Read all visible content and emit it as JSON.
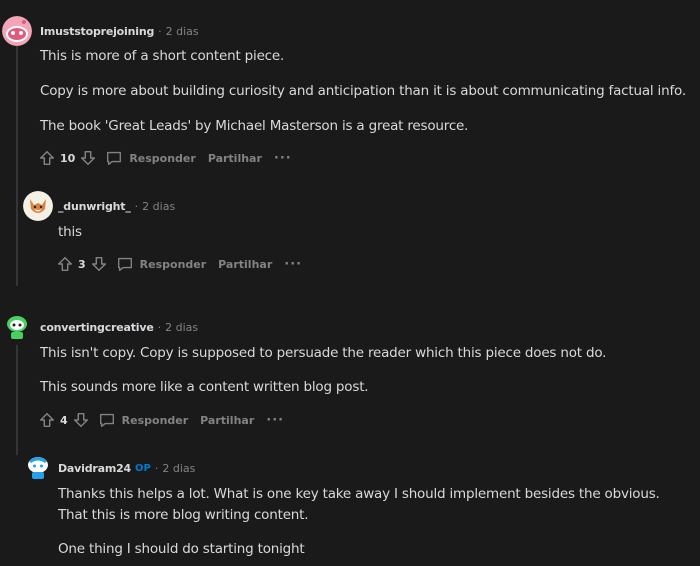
{
  "comments": [
    {
      "username": "Imuststoprejoining",
      "time": "2 dias",
      "avatar_icon": "pink-snoo-avatar-icon",
      "paragraphs": [
        "This is more of a short content piece.",
        "Copy is more about building curiosity and anticipation than it is about communicating factual info.",
        "The book 'Great Leads' by Michael Masterson is a great resource."
      ],
      "votes": "10",
      "reply_label": "Responder",
      "share_label": "Partilhar",
      "more_label": "···"
    },
    {
      "username": "_dunwright_",
      "time": "2 dias",
      "avatar_icon": "fox-avatar-icon",
      "paragraphs": [
        "this"
      ],
      "votes": "3",
      "reply_label": "Responder",
      "share_label": "Partilhar",
      "more_label": "···"
    },
    {
      "username": "convertingcreative",
      "time": "2 dias",
      "avatar_icon": "green-snoo-avatar-icon",
      "paragraphs": [
        "This isn't copy. Copy is supposed to persuade the reader which this piece does not do.",
        "This sounds more like a content written blog post."
      ],
      "votes": "4",
      "reply_label": "Responder",
      "share_label": "Partilhar",
      "more_label": "···"
    },
    {
      "username": "Davidram24",
      "op_badge": "OP",
      "time": "2 dias",
      "avatar_icon": "blue-snoo-avatar-icon",
      "paragraphs": [
        "Thanks this helps a lot. What is one key take away I should implement besides the obvious. That this is more blog writing content.",
        "One thing I should do starting tonight"
      ]
    }
  ],
  "separator": "·",
  "colors": {
    "background": "#1a1a1b",
    "text": "#d7dadc",
    "muted": "#818384",
    "op_badge": "#0079d3",
    "thread_line": "#343536"
  }
}
